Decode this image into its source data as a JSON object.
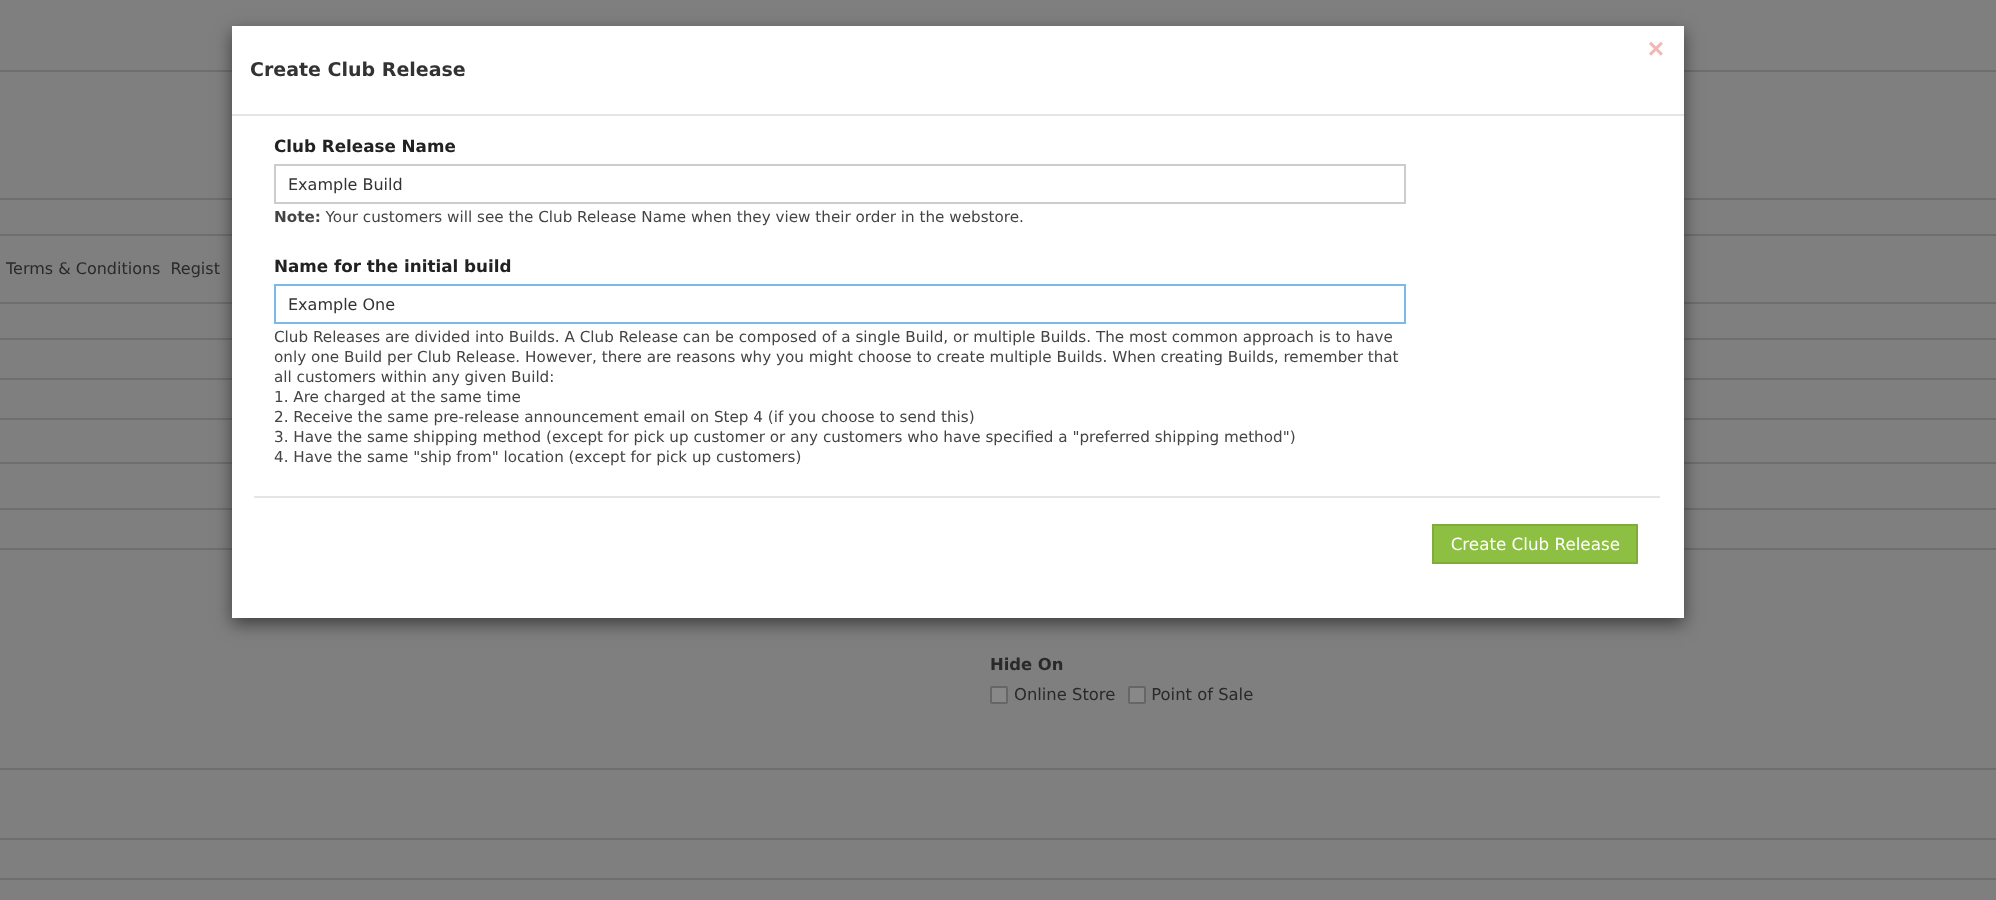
{
  "background": {
    "nav_links": [
      "Terms & Conditions",
      "Regist"
    ],
    "hide_on": {
      "label": "Hide On",
      "options": [
        {
          "label": "Online Store",
          "checked": false
        },
        {
          "label": "Point of Sale",
          "checked": false
        }
      ]
    }
  },
  "dialog": {
    "title": "Create Club Release",
    "close": "×",
    "fields": [
      {
        "label": "Club Release Name",
        "value": "Example Build",
        "focused": false,
        "note": "**Note:** Your customers will see the Club Release Name when they view their order in the webstore."
      },
      {
        "label": "Name for the initial build",
        "value": "Example One",
        "focused": true,
        "note": "Club Releases are divided into Builds. A Club Release can be composed of a single Build, or multiple Builds. The most common approach is to have only one Build per Club Release. However, there are reasons why you might choose to create multiple Builds. When creating Builds, remember that all customers within any given Build:"
      }
    ],
    "list": [
      "1. Are charged at the same time",
      "2. Receive the same pre-release announcement email on Step 4 (if you choose to send this)",
      "3. Have the same shipping method (except for pick up customer or any customers who have specified a \"preferred shipping method\")",
      "4. Have the same \"ship from\" location (except for pick up customers)"
    ],
    "button": "Create Club Release"
  }
}
